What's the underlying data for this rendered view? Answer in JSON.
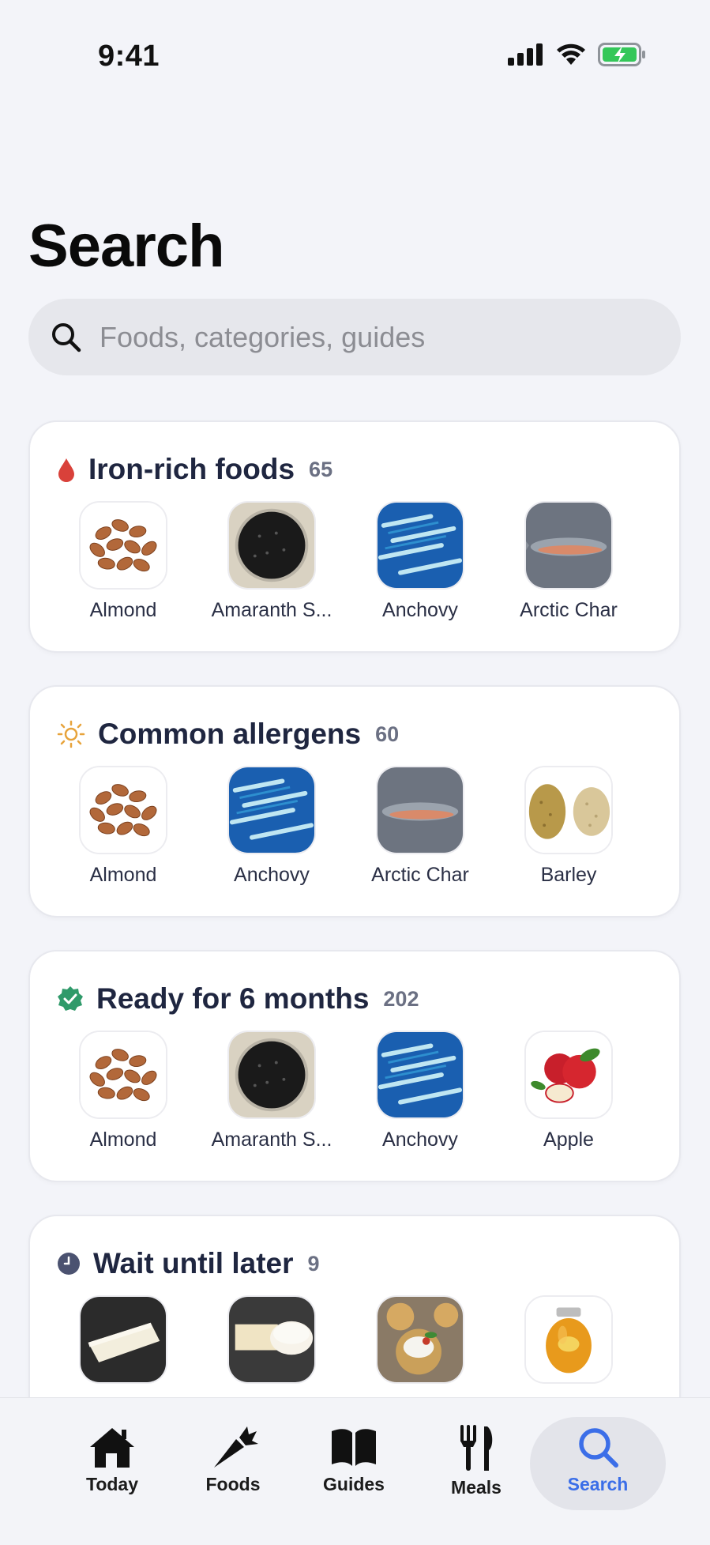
{
  "status_bar": {
    "time": "9:41"
  },
  "page": {
    "title": "Search"
  },
  "search": {
    "placeholder": "Foods, categories, guides",
    "value": ""
  },
  "sections": [
    {
      "title": "Iron-rich foods",
      "count": "65",
      "icon": "blood-drop-icon",
      "icon_color": "#d9413a",
      "items": [
        {
          "label": "Almond",
          "image": "almonds"
        },
        {
          "label": "Amaranth S...",
          "image": "amaranth-seeds"
        },
        {
          "label": "Anchovy",
          "image": "anchovy"
        },
        {
          "label": "Arctic Char",
          "image": "arctic-char"
        }
      ]
    },
    {
      "title": "Common allergens",
      "count": "60",
      "icon": "allergen-sun-icon",
      "icon_color": "#e7a33b",
      "items": [
        {
          "label": "Almond",
          "image": "almonds"
        },
        {
          "label": "Anchovy",
          "image": "anchovy"
        },
        {
          "label": "Arctic Char",
          "image": "arctic-char"
        },
        {
          "label": "Barley",
          "image": "barley"
        }
      ]
    },
    {
      "title": "Ready for 6 months",
      "count": "202",
      "icon": "check-badge-icon",
      "icon_color": "#2f9a6a",
      "items": [
        {
          "label": "Almond",
          "image": "almonds"
        },
        {
          "label": "Amaranth S...",
          "image": "amaranth-seeds"
        },
        {
          "label": "Anchovy",
          "image": "anchovy"
        },
        {
          "label": "Apple",
          "image": "apple"
        }
      ]
    },
    {
      "title": "Wait until later",
      "count": "9",
      "icon": "clock-icon",
      "icon_color": "#4b5270",
      "items": [
        {
          "label": "",
          "image": "brie"
        },
        {
          "label": "",
          "image": "camembert"
        },
        {
          "label": "",
          "image": "cheese-crackers"
        },
        {
          "label": "",
          "image": "honey"
        }
      ]
    }
  ],
  "tab_bar": {
    "tabs": [
      {
        "label": "Today",
        "icon": "house-icon"
      },
      {
        "label": "Foods",
        "icon": "carrot-icon"
      },
      {
        "label": "Guides",
        "icon": "book-icon"
      },
      {
        "label": "Meals",
        "icon": "fork-knife-icon"
      },
      {
        "label": "Search",
        "icon": "search-icon",
        "active": true
      }
    ],
    "active_color": "#3b6ee8"
  }
}
